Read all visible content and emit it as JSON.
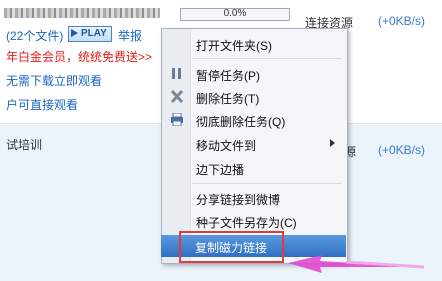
{
  "task1": {
    "progress": "0.0%",
    "peer_status": "连接资源",
    "speed": "(+0KB/s)",
    "file_count": "(22个文件)",
    "play_label": "PLAY",
    "report_label": "举报",
    "promo": "年白金会员，统统免费送>>",
    "line3": "无需下载立即观看",
    "line4": "户可直接观看"
  },
  "task2": {
    "name": "试培训",
    "peer_status": "源",
    "speed": "(+0KB/s)"
  },
  "context_menu": {
    "items": [
      {
        "label": "打开文件夹(S)"
      },
      {
        "label": "暂停任务(P)",
        "icon": "pause-icon"
      },
      {
        "label": "删除任务(T)",
        "icon": "delete-x-icon"
      },
      {
        "label": "彻底删除任务(Q)",
        "icon": "printer-icon"
      },
      {
        "label": "移动文件到",
        "icon": "submenu-arrow-icon"
      },
      {
        "label": "边下边播"
      },
      {
        "label": "分享链接到微博"
      },
      {
        "label": "种子文件另存为(C)"
      },
      {
        "label": "复制磁力链接"
      }
    ]
  },
  "colors": {
    "link_blue": "#1a66c2",
    "promo_red": "#e0201a",
    "menu_highlight": "#3f80cf",
    "annotation_red": "#e23b3b",
    "annotation_arrow": "#e040d0"
  }
}
